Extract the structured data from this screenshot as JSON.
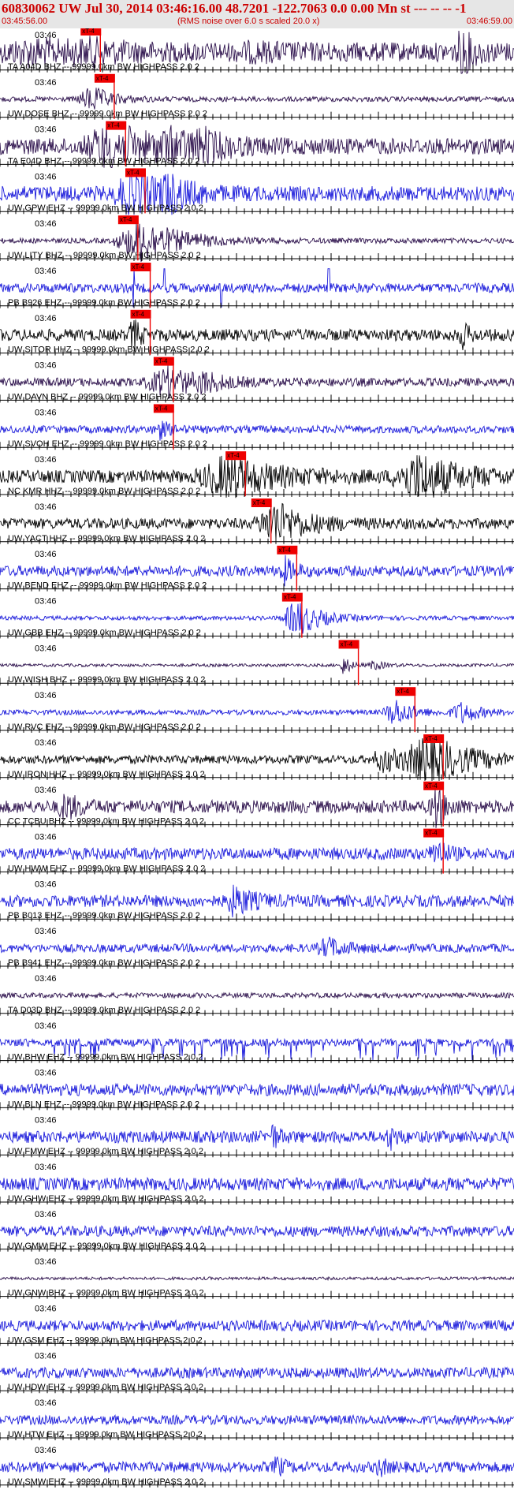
{
  "header": {
    "title": "60830062 UW Jul 30, 2014 03:46:16.00   48.7201 -122.7063  0.0 0.00 Mn st --- -- --  -1",
    "start_time": "03:45:56.00",
    "noise_note": "(RMS noise over 6.0 s scaled 20.0 x)",
    "end_time": "03:46:59.00"
  },
  "time_label": "03:46",
  "pick_label": "xT-4",
  "colors": {
    "dark": "#2a0e4a",
    "blue": "#1a1adb",
    "black": "#000000",
    "pick": "#ee0000",
    "header": "#cc0000"
  },
  "traces": [
    {
      "label": "TA A04D BHZ --  99999.0km BW  HIGHPASS  2.0  2",
      "color": "dark",
      "pick": 0.163,
      "amp": 0.45,
      "events": [
        [
          0.07,
          0.35,
          0.15
        ],
        [
          0.18,
          0.22,
          0.1
        ],
        [
          0.5,
          0.15,
          0.1
        ],
        [
          0.9,
          1.0,
          0.03
        ]
      ]
    },
    {
      "label": "UW DOSE BHZ --  99999.0km BW  HIGHPASS  2.0  2",
      "color": "dark",
      "pick": 0.19,
      "amp": 0.12,
      "events": [
        [
          0.18,
          0.55,
          0.06
        ]
      ]
    },
    {
      "label": "TA E04D BHZ --  99999.0km BW  HIGHPASS  2.0  2",
      "color": "dark",
      "pick": 0.212,
      "amp": 0.38,
      "events": [
        [
          0.22,
          0.9,
          0.12
        ],
        [
          0.34,
          0.45,
          0.1
        ],
        [
          0.4,
          0.35,
          0.06
        ]
      ]
    },
    {
      "label": "UW GPW EHZ --  99999.0km BW  HIGHPASS  2.0  2",
      "color": "blue",
      "pick": 0.25,
      "amp": 0.35,
      "events": [
        [
          0.26,
          1.0,
          0.08
        ],
        [
          0.33,
          0.6,
          0.06
        ]
      ]
    },
    {
      "label": "UW LITY BHZ --  99999.0km BW  HIGHPASS  2.0  2",
      "color": "dark",
      "pick": 0.236,
      "amp": 0.12,
      "events": [
        [
          0.28,
          0.95,
          0.12
        ]
      ]
    },
    {
      "label": "PB B926 EHZ --  99999.0km BW  HIGHPASS  2.0  2",
      "color": "blue",
      "pick": 0.26,
      "amp": 0.22,
      "spikes": [
        0.26,
        0.32,
        0.43,
        0.64
      ],
      "events": []
    },
    {
      "label": "UW SITOR HHZ --  99999.0km BW  HIGHPASS  2.0  2",
      "color": "black",
      "pick": 0.26,
      "amp": 0.28,
      "events": [
        [
          0.26,
          0.7,
          0.02
        ],
        [
          0.9,
          0.5,
          0.02
        ]
      ]
    },
    {
      "label": "UW DAVN BHZ --  99999.0km BW  HIGHPASS  2.0  2",
      "color": "dark",
      "pick": 0.305,
      "amp": 0.2,
      "events": [
        [
          0.33,
          0.6,
          0.1
        ],
        [
          0.4,
          0.3,
          0.04
        ]
      ]
    },
    {
      "label": "UW SVOH EHZ --  99999.0km BW  HIGHPASS  2.0  2",
      "color": "blue",
      "pick": 0.305,
      "amp": 0.18,
      "events": [
        [
          0.31,
          0.4,
          0.03
        ]
      ]
    },
    {
      "label": "NC KMR HHZ --  99999.0km BW  HIGHPASS  2.0  2",
      "color": "black",
      "pick": 0.445,
      "amp": 0.3,
      "events": [
        [
          0.45,
          0.85,
          0.14
        ],
        [
          0.82,
          0.95,
          0.12
        ]
      ]
    },
    {
      "label": "UW YACT HHZ --  99999.0km BW  HIGHPASS  2.0  2",
      "color": "black",
      "pick": 0.495,
      "amp": 0.25,
      "events": [
        [
          0.54,
          0.9,
          0.09
        ]
      ]
    },
    {
      "label": "UW BEND EHZ --  99999.0km BW  HIGHPASS  2.0  2",
      "color": "blue",
      "pick": 0.545,
      "amp": 0.25,
      "events": [
        [
          0.555,
          0.5,
          0.03
        ]
      ]
    },
    {
      "label": "UW GBB EHZ --  99999.0km BW  HIGHPASS  2.0  2",
      "color": "blue",
      "pick": 0.555,
      "amp": 0.1,
      "events": [
        [
          0.58,
          0.8,
          0.07
        ]
      ]
    },
    {
      "label": "UW WISH BHZ --  99999.0km BW  HIGHPASS  2.0  2",
      "color": "dark",
      "pick": 0.665,
      "amp": 0.07,
      "events": [
        [
          0.67,
          0.45,
          0.02
        ],
        [
          0.73,
          0.2,
          0.03
        ]
      ]
    },
    {
      "label": "UW RVC EHZ --  99999.0km BW  HIGHPASS  2.0  2",
      "color": "blue",
      "pick": 0.775,
      "amp": 0.12,
      "events": [
        [
          0.77,
          0.6,
          0.05
        ],
        [
          0.9,
          0.45,
          0.05
        ]
      ]
    },
    {
      "label": "UW IRON HHZ --  99999.0km BW  HIGHPASS  2.0  2",
      "color": "black",
      "pick": 0.83,
      "amp": 0.2,
      "events": [
        [
          0.84,
          1.0,
          0.12
        ],
        [
          0.75,
          0.5,
          0.06
        ]
      ]
    },
    {
      "label": "CC TCBU BHZ --  99999.0km BW  HIGHPASS  2.0  2",
      "color": "dark",
      "pick": 0.83,
      "amp": 0.3,
      "events": [
        [
          0.13,
          0.5,
          0.04
        ],
        [
          0.85,
          0.8,
          0.03
        ]
      ]
    },
    {
      "label": "UW HWW EHZ --  99999.0km BW  HIGHPASS  2.0  2",
      "color": "blue",
      "pick": 0.83,
      "amp": 0.28,
      "events": [
        [
          0.85,
          0.6,
          0.03
        ]
      ]
    },
    {
      "label": "PB B013 EHZ --  99999.0km BW  HIGHPASS  2.0  2",
      "color": "blue",
      "pick": null,
      "amp": 0.28,
      "events": [
        [
          0.46,
          0.6,
          0.05
        ]
      ]
    },
    {
      "label": "PB B941 EHZ --  99999.0km BW  HIGHPASS  2.0  2",
      "color": "blue",
      "pick": null,
      "amp": 0.2,
      "events": [
        [
          0.64,
          0.4,
          0.05
        ]
      ]
    },
    {
      "label": "TA D03D BHZ --  99999.0km BW  HIGHPASS  2.0  2",
      "color": "dark",
      "pick": null,
      "amp": 0.12,
      "events": []
    },
    {
      "label": "UW BHW EHZ --  99999.0km BW  HIGHPASS  2.0  2",
      "color": "blue",
      "pick": null,
      "amp": 0.18,
      "spikes": "many",
      "events": []
    },
    {
      "label": "UW BLN EHZ --  99999.0km BW  HIGHPASS  2.0  2",
      "color": "blue",
      "pick": null,
      "amp": 0.28,
      "events": []
    },
    {
      "label": "UW FMW EHZ --  99999.0km BW  HIGHPASS  2.0  2",
      "color": "blue",
      "pick": null,
      "amp": 0.28,
      "events": [
        [
          0.53,
          0.5,
          0.02
        ],
        [
          0.76,
          0.45,
          0.02
        ]
      ]
    },
    {
      "label": "UW GHW EHZ --  99999.0km BW  HIGHPASS  2.0  2",
      "color": "blue",
      "pick": null,
      "amp": 0.3,
      "events": []
    },
    {
      "label": "UW GMW EHZ --  99999.0km BW  HIGHPASS  2.0  2",
      "color": "blue",
      "pick": null,
      "amp": 0.25,
      "events": []
    },
    {
      "label": "UW GNW BHZ --  99999.0km BW  HIGHPASS  2.0  2",
      "color": "dark",
      "pick": null,
      "amp": 0.07,
      "events": []
    },
    {
      "label": "UW GSM EHZ --  99999.0km BW  HIGHPASS  2.0  2",
      "color": "blue",
      "pick": null,
      "amp": 0.25,
      "events": []
    },
    {
      "label": "UW HDW EHZ --  99999.0km BW  HIGHPASS  2.0  2",
      "color": "blue",
      "pick": null,
      "amp": 0.25,
      "events": []
    },
    {
      "label": "UW HTW EHZ --  99999.0km BW  HIGHPASS  2.0  2",
      "color": "blue",
      "pick": null,
      "amp": 0.22,
      "events": []
    },
    {
      "label": "UW SMW EHZ --  99999.0km BW  HIGHPASS  2.0  2",
      "color": "blue",
      "pick": null,
      "amp": 0.25,
      "events": [
        [
          0.54,
          0.4,
          0.02
        ],
        [
          0.74,
          0.35,
          0.02
        ]
      ]
    }
  ]
}
